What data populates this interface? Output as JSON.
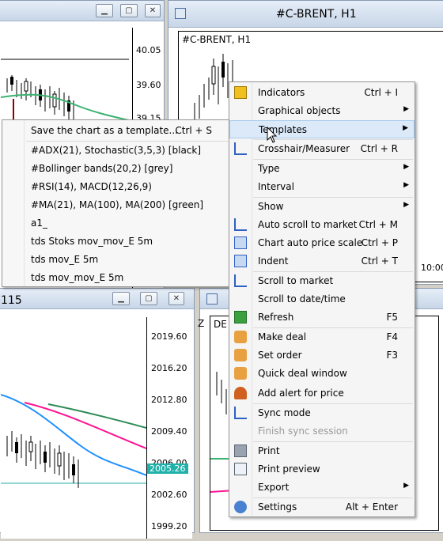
{
  "left_top_window": {
    "price_ticks": [
      "40.05",
      "39.60",
      "39.15"
    ]
  },
  "brent_window": {
    "title": "#C-BRENT, H1",
    "chart_label": "#C-BRENT, H1",
    "time_label": "10:00"
  },
  "bottom_left_window": {
    "title_partial": "115",
    "price_ticks": [
      "2019.60",
      "2016.20",
      "2012.80",
      "2009.40",
      "2006.00",
      "2002.60",
      "1999.20"
    ],
    "current_price": "2005.26"
  },
  "bottom_mid_window": {
    "title_partial": "Z",
    "chart_label_partial": "DE"
  },
  "templates_submenu": {
    "items": [
      {
        "label": "Save the chart as a template...",
        "shortcut": "Ctrl + S"
      },
      {
        "label": "#ADX(21), Stochastic(3,5,3) [black]"
      },
      {
        "label": "#Bollinger bands(20,2) [grey]"
      },
      {
        "label": "#RSI(14), MACD(12,26,9)"
      },
      {
        "label": "#MA(21), MA(100), MA(200) [green]"
      },
      {
        "label": "a1_"
      },
      {
        "label": "tds Stoks mov_mov_E 5m"
      },
      {
        "label": "tds mov_E 5m"
      },
      {
        "label": "tds mov_mov_E 5m"
      }
    ]
  },
  "context_menu": {
    "items": [
      {
        "label": "Indicators",
        "shortcut": "Ctrl + I",
        "icon": "indicators-icon"
      },
      {
        "label": "Graphical objects",
        "submenu": true
      },
      {
        "label": "Templates",
        "submenu": true,
        "highlighted": true
      },
      {
        "label": "Crosshair/Measurer",
        "shortcut": "Ctrl + R",
        "icon": "crosshair-icon"
      },
      {
        "label": "Type",
        "submenu": true
      },
      {
        "label": "Interval",
        "submenu": true
      },
      {
        "label": "Show",
        "submenu": true
      },
      {
        "label": "Auto scroll to market",
        "shortcut": "Ctrl + M",
        "icon": "auto-scroll-icon"
      },
      {
        "label": "Chart auto price scale",
        "shortcut": "Ctrl + P",
        "icon": "auto-scale-icon"
      },
      {
        "label": "Indent",
        "shortcut": "Ctrl + T",
        "icon": "indent-icon"
      },
      {
        "label": "Scroll to market",
        "icon": "scroll-market-icon"
      },
      {
        "label": "Scroll to date/time"
      },
      {
        "label": "Refresh",
        "shortcut": "F5",
        "icon": "refresh-icon"
      },
      {
        "label": "Make deal",
        "shortcut": "F4",
        "icon": "make-deal-icon"
      },
      {
        "label": "Set order",
        "shortcut": "F3",
        "icon": "set-order-icon"
      },
      {
        "label": "Quick deal window",
        "icon": "quick-deal-icon"
      },
      {
        "label": "Add alert for price",
        "icon": "alert-icon"
      },
      {
        "label": "Sync mode",
        "icon": "sync-icon"
      },
      {
        "label": "Finish sync session",
        "disabled": true
      },
      {
        "label": "Print",
        "icon": "print-icon"
      },
      {
        "label": "Print preview",
        "icon": "print-preview-icon"
      },
      {
        "label": "Export",
        "submenu": true
      },
      {
        "label": "Settings",
        "shortcut": "Alt + Enter",
        "icon": "settings-icon"
      }
    ]
  }
}
